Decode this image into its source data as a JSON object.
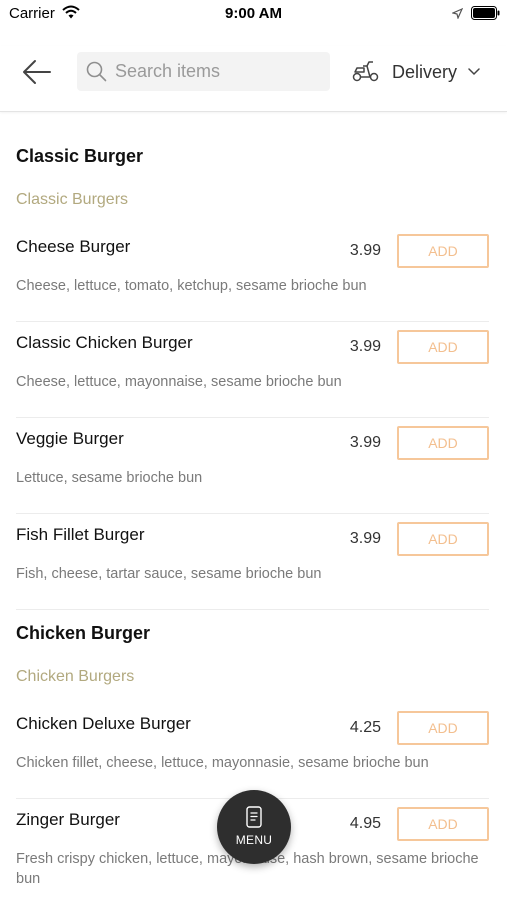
{
  "status_bar": {
    "carrier": "Carrier",
    "time": "9:00 AM"
  },
  "header": {
    "search": {
      "placeholder": "Search items",
      "value": ""
    },
    "delivery_label": "Delivery"
  },
  "sections": [
    {
      "title": "Classic Burger",
      "subtitle": "Classic Burgers",
      "items": [
        {
          "name": "Cheese Burger",
          "price": "3.99",
          "add_label": "ADD",
          "description": "Cheese, lettuce, tomato, ketchup, sesame brioche bun"
        },
        {
          "name": "Classic Chicken Burger",
          "price": "3.99",
          "add_label": "ADD",
          "description": "Cheese, lettuce, mayonnaise, sesame brioche bun"
        },
        {
          "name": "Veggie Burger",
          "price": "3.99",
          "add_label": "ADD",
          "description": "Lettuce, sesame brioche bun"
        },
        {
          "name": "Fish Fillet Burger",
          "price": "3.99",
          "add_label": "ADD",
          "description": "Fish, cheese, tartar sauce, sesame brioche bun"
        }
      ]
    },
    {
      "title": "Chicken Burger",
      "subtitle": "Chicken Burgers",
      "items": [
        {
          "name": "Chicken Deluxe Burger",
          "price": "4.25",
          "add_label": "ADD",
          "description": "Chicken fillet, cheese, lettuce, mayonnasie, sesame brioche bun"
        },
        {
          "name": "Zinger Burger",
          "price": "4.95",
          "add_label": "ADD",
          "description": "Fresh crispy chicken, lettuce, mayonnaise, hash brown, sesame brioche bun"
        }
      ]
    }
  ],
  "fab": {
    "label": "MENU"
  },
  "colors": {
    "accent": "#f6c79a",
    "subcategory": "#b2a97f",
    "fab_background": "#2e2e2e"
  },
  "icons": [
    "wifi-icon",
    "location-icon",
    "battery-icon",
    "back-arrow-icon",
    "search-icon",
    "scooter-icon",
    "chevron-down-icon",
    "menu-icon"
  ]
}
